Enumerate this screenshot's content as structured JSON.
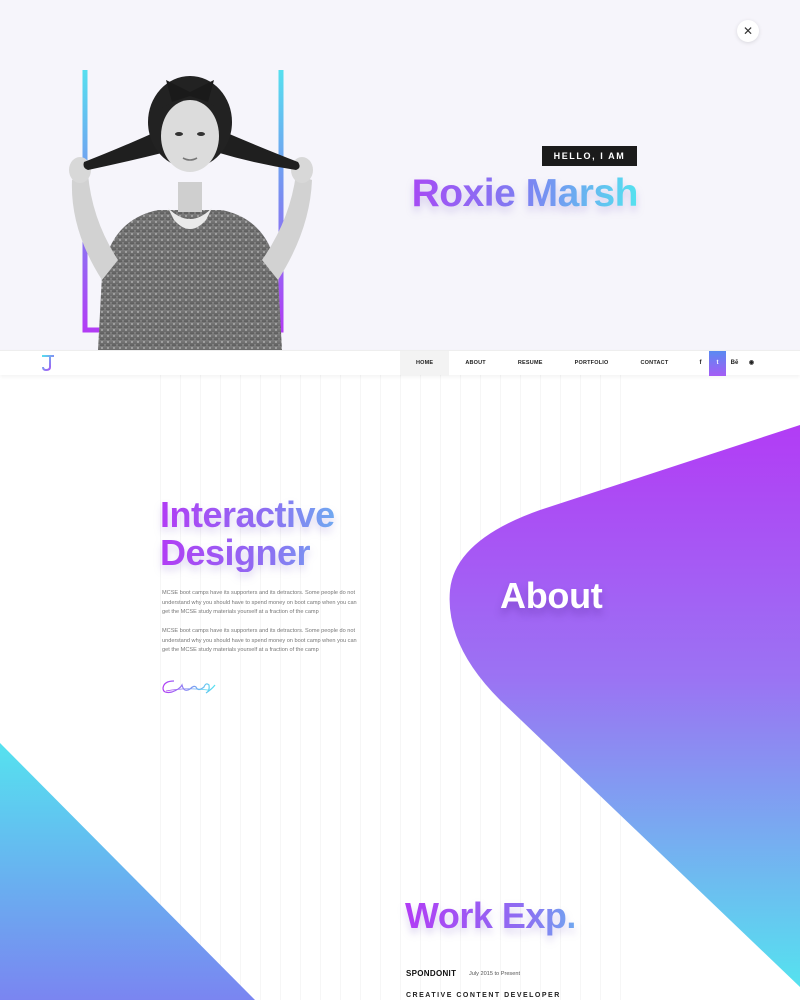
{
  "hero": {
    "close_icon": "close-icon",
    "hello_label": "HELLO, I AM",
    "name": "Roxie Marsh"
  },
  "nav": {
    "items": [
      {
        "label": "HOME",
        "active": true
      },
      {
        "label": "ABOUT",
        "active": false
      },
      {
        "label": "RESUME",
        "active": false
      },
      {
        "label": "PORTFOLIO",
        "active": false
      },
      {
        "label": "CONTACT",
        "active": false
      }
    ],
    "social": [
      {
        "icon": "facebook-icon",
        "glyph": "f"
      },
      {
        "icon": "twitter-icon",
        "glyph": "t"
      },
      {
        "icon": "behance-icon",
        "glyph": "Bē"
      },
      {
        "icon": "github-icon",
        "glyph": "◉"
      }
    ]
  },
  "about": {
    "headline_line1": "Interactive",
    "headline_line2": "Designer",
    "paragraph1": "MCSE boot camps have its supporters and its detractors. Some people do not understand why you should have to spend money on boot camp when you can get the MCSE study materials yourself at a fraction of the camp",
    "paragraph2": "MCSE boot camps have its supporters and its detractors. Some people do not understand why you should have to spend money on boot camp when you can get the MCSE study materials yourself at a fraction of the camp",
    "section_title": "About"
  },
  "work": {
    "section_title": "Work Exp.",
    "company": "SPONDONIT",
    "date": "July 2015 to Present",
    "role": "CREATIVE CONTENT DEVELOPER"
  },
  "colors": {
    "accent_purple": "#b23cf5",
    "accent_blue": "#8a7ff2",
    "accent_cyan": "#55e2ef",
    "dark": "#1b1b1b"
  }
}
